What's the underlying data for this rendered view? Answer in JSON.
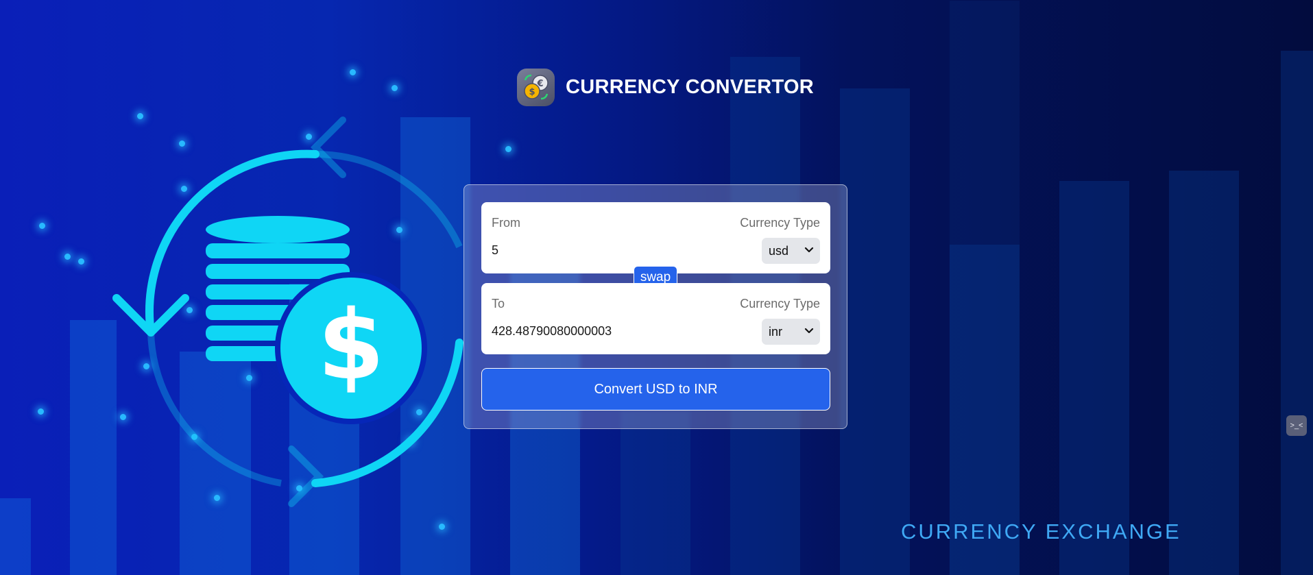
{
  "header": {
    "title": "CURRENCY CONVERTOR",
    "logo_icon": "currency-exchange-icon"
  },
  "converter": {
    "from": {
      "label": "From",
      "currency_type_label": "Currency Type",
      "amount": "5",
      "currency": "usd"
    },
    "to": {
      "label": "To",
      "currency_type_label": "Currency Type",
      "amount": "428.48790080000003",
      "currency": "inr"
    },
    "swap_label": "swap",
    "convert_label": "Convert USD to INR"
  },
  "background": {
    "brand_text": "CURRENCY EXCHANGE",
    "illustration": "coins-dollar-exchange-icon"
  },
  "extension": {
    "icon": "browser-extension-icon",
    "glyph": ">_<"
  },
  "colors": {
    "accent": "#2563eb",
    "brand_text": "#3fa9f5",
    "illustration": "#0fd6f5"
  }
}
